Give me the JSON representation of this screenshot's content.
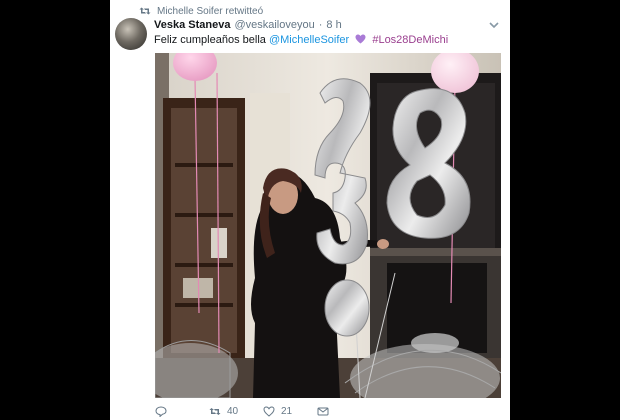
{
  "retweet": {
    "label": "Michelle Soifer retwitteó"
  },
  "tweet": {
    "display_name": "Veska Staneva",
    "handle": "@veskailoveyou",
    "separator": "·",
    "time": "8 h",
    "text_before": "Feliz cumpleaños bella",
    "mention": "@MichelleSoifer",
    "hashtag": "#Los28DeMichi",
    "image_number": "28"
  },
  "actions": {
    "reply_count": "",
    "retweet_count": "40",
    "like_count": "21"
  },
  "colors": {
    "link": "#1b95e0",
    "hashtag": "#9a3f8f",
    "muted": "#657786",
    "heart_purple": "#a97bd6",
    "backdrop": "#000000"
  },
  "icons": [
    "retweet-icon",
    "caret-down-icon",
    "purple-heart-icon",
    "reply-icon",
    "like-icon",
    "message-icon"
  ]
}
